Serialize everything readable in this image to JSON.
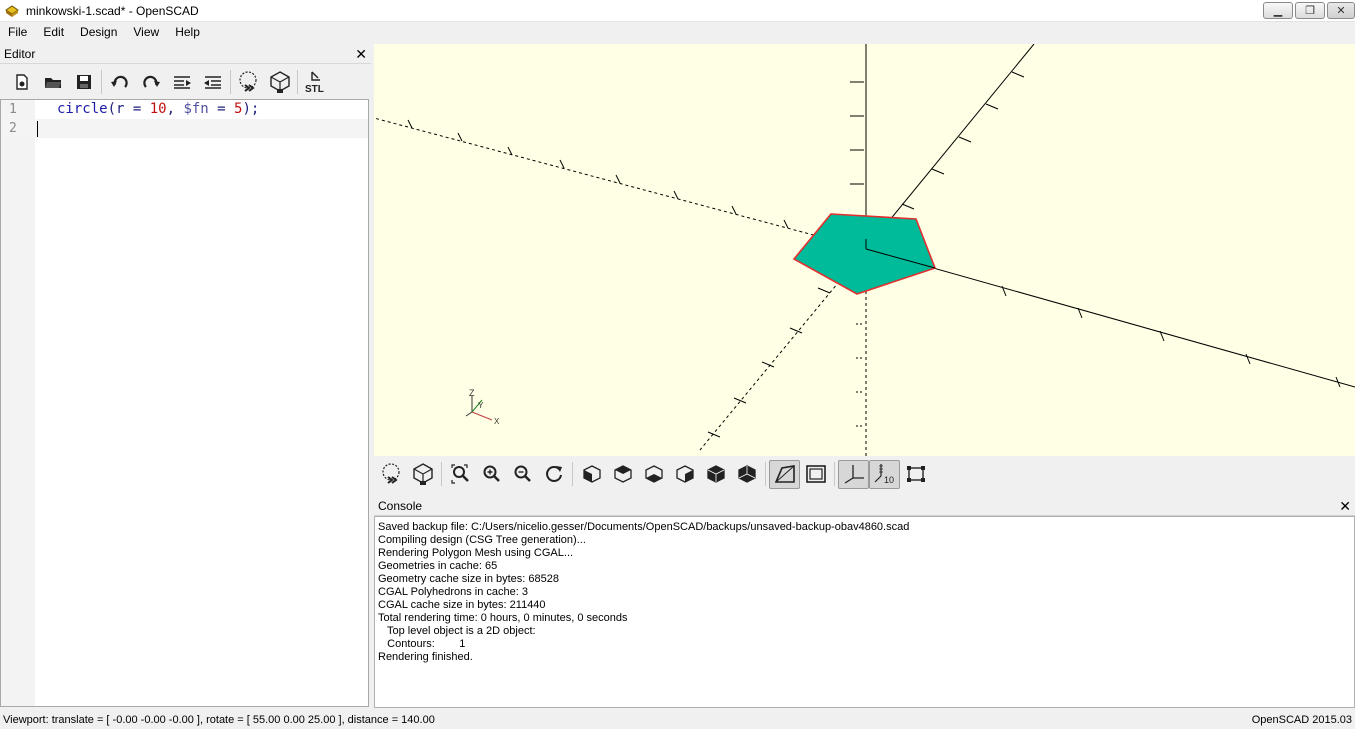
{
  "window": {
    "title": "minkowski-1.scad* - OpenSCAD",
    "minimize_glyph": "▁",
    "restore_glyph": "❐",
    "close_glyph": "✕"
  },
  "menu": [
    "File",
    "Edit",
    "Design",
    "View",
    "Help"
  ],
  "editor": {
    "panel_title": "Editor",
    "close_glyph": "✕",
    "stl_label": "STL",
    "lines": [
      {
        "number": "1",
        "code": "circle(r = 10, $fn = 5);"
      },
      {
        "number": "2",
        "code": ""
      }
    ]
  },
  "viewport": {
    "background": "#ffffe5",
    "shape_fill": "#00bb99",
    "shape_stroke": "#e03030",
    "axis_labels": {
      "z": "Z",
      "y": "Y",
      "x": "X"
    },
    "scale_marker": "10"
  },
  "console": {
    "panel_title": "Console",
    "close_glyph": "✕",
    "lines": [
      "Saved backup file: C:/Users/nicelio.gesser/Documents/OpenSCAD/backups/unsaved-backup-obav4860.scad",
      "Compiling design (CSG Tree generation)...",
      "Rendering Polygon Mesh using CGAL...",
      "Geometries in cache: 65",
      "Geometry cache size in bytes: 68528",
      "CGAL Polyhedrons in cache: 3",
      "CGAL cache size in bytes: 211440",
      "Total rendering time: 0 hours, 0 minutes, 0 seconds",
      "   Top level object is a 2D object:",
      "   Contours:        1",
      "Rendering finished."
    ]
  },
  "status": {
    "viewport_info": "Viewport: translate = [ -0.00 -0.00 -0.00 ], rotate = [ 55.00 0.00 25.00 ], distance = 140.00",
    "version": "OpenSCAD 2015.03"
  }
}
